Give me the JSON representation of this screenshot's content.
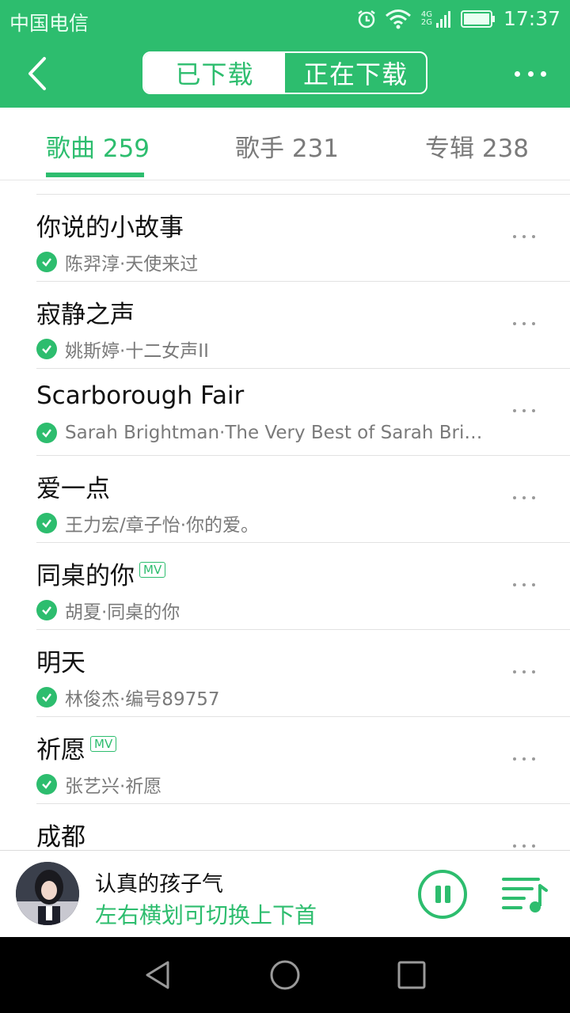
{
  "status_bar": {
    "carrier": "中国电信",
    "network": "4G 2G",
    "time": "17:37"
  },
  "header": {
    "segments": [
      "已下载",
      "正在下载"
    ],
    "selected_segment": 0
  },
  "tabs": [
    {
      "label": "歌曲 259",
      "active": true
    },
    {
      "label": "歌手 231",
      "active": false
    },
    {
      "label": "专辑 238",
      "active": false
    }
  ],
  "songs": [
    {
      "title": "你说的小故事",
      "mv": false,
      "subtitle": "陈羿淳·天使来过",
      "downloaded": true
    },
    {
      "title": "寂静之声",
      "mv": false,
      "subtitle": "姚斯婷·十二女声II",
      "downloaded": true
    },
    {
      "title": "Scarborough Fair",
      "mv": false,
      "subtitle": "Sarah Brightman·The Very Best of Sarah Brightm...",
      "downloaded": true
    },
    {
      "title": "爱一点",
      "mv": false,
      "subtitle": "王力宏/章子怡·你的爱。",
      "downloaded": true
    },
    {
      "title": "同桌的你",
      "mv": true,
      "subtitle": "胡夏·同桌的你",
      "downloaded": true
    },
    {
      "title": "明天",
      "mv": false,
      "subtitle": "林俊杰·编号89757",
      "downloaded": true
    },
    {
      "title": "祈愿",
      "mv": true,
      "subtitle": "张艺兴·祈愿",
      "downloaded": true
    },
    {
      "title": "成都",
      "mv": false,
      "subtitle": "",
      "downloaded": true
    }
  ],
  "mv_badge": "MV",
  "player": {
    "song_title": "认真的孩子气",
    "hint": "左右横划可切换上下首",
    "state": "playing"
  },
  "colors": {
    "accent": "#2dbd6e",
    "text": "#111111",
    "muted": "#7a7a7a"
  },
  "icons": [
    "back-icon",
    "more-icon",
    "check-icon",
    "pause-icon",
    "playlist-icon",
    "nav-back-icon",
    "nav-home-icon",
    "nav-recents-icon",
    "alarm-icon",
    "wifi-icon",
    "signal-icon",
    "battery-icon"
  ]
}
